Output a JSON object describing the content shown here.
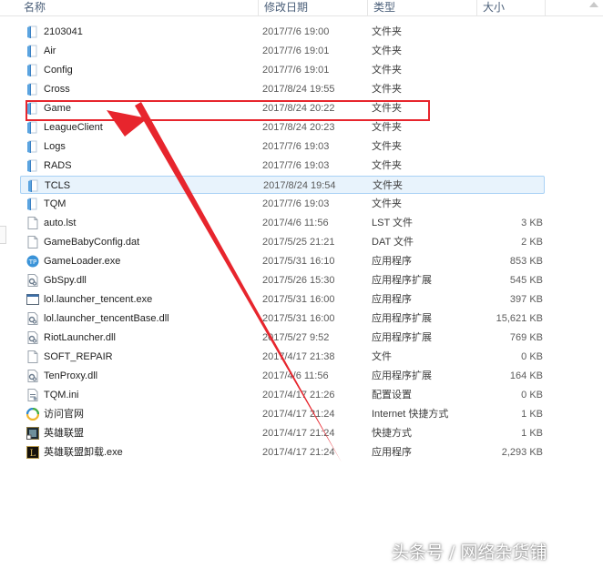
{
  "columns": {
    "name": "名称",
    "date": "修改日期",
    "type": "类型",
    "size": "大小"
  },
  "files": [
    {
      "name": "2103041",
      "date": "2017/7/6 19:00",
      "type": "文件夹",
      "size": "",
      "icon": "folder-icon"
    },
    {
      "name": "Air",
      "date": "2017/7/6 19:01",
      "type": "文件夹",
      "size": "",
      "icon": "folder-icon"
    },
    {
      "name": "Config",
      "date": "2017/7/6 19:01",
      "type": "文件夹",
      "size": "",
      "icon": "folder-icon"
    },
    {
      "name": "Cross",
      "date": "2017/8/24 19:55",
      "type": "文件夹",
      "size": "",
      "icon": "folder-icon"
    },
    {
      "name": "Game",
      "date": "2017/8/24 20:22",
      "type": "文件夹",
      "size": "",
      "icon": "folder-icon"
    },
    {
      "name": "LeagueClient",
      "date": "2017/8/24 20:23",
      "type": "文件夹",
      "size": "",
      "icon": "folder-icon"
    },
    {
      "name": "Logs",
      "date": "2017/7/6 19:03",
      "type": "文件夹",
      "size": "",
      "icon": "folder-icon"
    },
    {
      "name": "RADS",
      "date": "2017/7/6 19:03",
      "type": "文件夹",
      "size": "",
      "icon": "folder-icon"
    },
    {
      "name": "TCLS",
      "date": "2017/8/24 19:54",
      "type": "文件夹",
      "size": "",
      "icon": "folder-icon"
    },
    {
      "name": "TQM",
      "date": "2017/7/6 19:03",
      "type": "文件夹",
      "size": "",
      "icon": "folder-icon"
    },
    {
      "name": "auto.lst",
      "date": "2017/4/6 11:56",
      "type": "LST 文件",
      "size": "3 KB",
      "icon": "file-icon"
    },
    {
      "name": "GameBabyConfig.dat",
      "date": "2017/5/25 21:21",
      "type": "DAT 文件",
      "size": "2 KB",
      "icon": "file-icon"
    },
    {
      "name": "GameLoader.exe",
      "date": "2017/5/31 16:10",
      "type": "应用程序",
      "size": "853 KB",
      "icon": "tp-app-icon"
    },
    {
      "name": "GbSpy.dll",
      "date": "2017/5/26 15:30",
      "type": "应用程序扩展",
      "size": "545 KB",
      "icon": "dll-icon"
    },
    {
      "name": "lol.launcher_tencent.exe",
      "date": "2017/5/31 16:00",
      "type": "应用程序",
      "size": "397 KB",
      "icon": "app-window-icon"
    },
    {
      "name": "lol.launcher_tencentBase.dll",
      "date": "2017/5/31 16:00",
      "type": "应用程序扩展",
      "size": "15,621 KB",
      "icon": "dll-icon"
    },
    {
      "name": "RiotLauncher.dll",
      "date": "2017/5/27 9:52",
      "type": "应用程序扩展",
      "size": "769 KB",
      "icon": "dll-icon"
    },
    {
      "name": "SOFT_REPAIR",
      "date": "2017/4/17 21:38",
      "type": "文件",
      "size": "0 KB",
      "icon": "file-icon"
    },
    {
      "name": "TenProxy.dll",
      "date": "2017/4/6 11:56",
      "type": "应用程序扩展",
      "size": "164 KB",
      "icon": "dll-icon"
    },
    {
      "name": "TQM.ini",
      "date": "2017/4/17 21:26",
      "type": "配置设置",
      "size": "0 KB",
      "icon": "ini-icon"
    },
    {
      "name": "访问官网",
      "date": "2017/4/17 21:24",
      "type": "Internet 快捷方式",
      "size": "1 KB",
      "icon": "internet-shortcut-icon"
    },
    {
      "name": "英雄联盟",
      "date": "2017/4/17 21:24",
      "type": "快捷方式",
      "size": "1 KB",
      "icon": "lol-shortcut-icon"
    },
    {
      "name": "英雄联盟卸载.exe",
      "date": "2017/4/17 21:24",
      "type": "应用程序",
      "size": "2,293 KB",
      "icon": "lol-uninstall-icon"
    }
  ],
  "hover_row": 8,
  "highlighted_row": 4,
  "watermark": "头条号 / 网络杂货铺",
  "colors": {
    "annotation_red": "#e7252d",
    "folder_blue": "#5ba4e0",
    "hover_bg": "#e8f3fc"
  }
}
